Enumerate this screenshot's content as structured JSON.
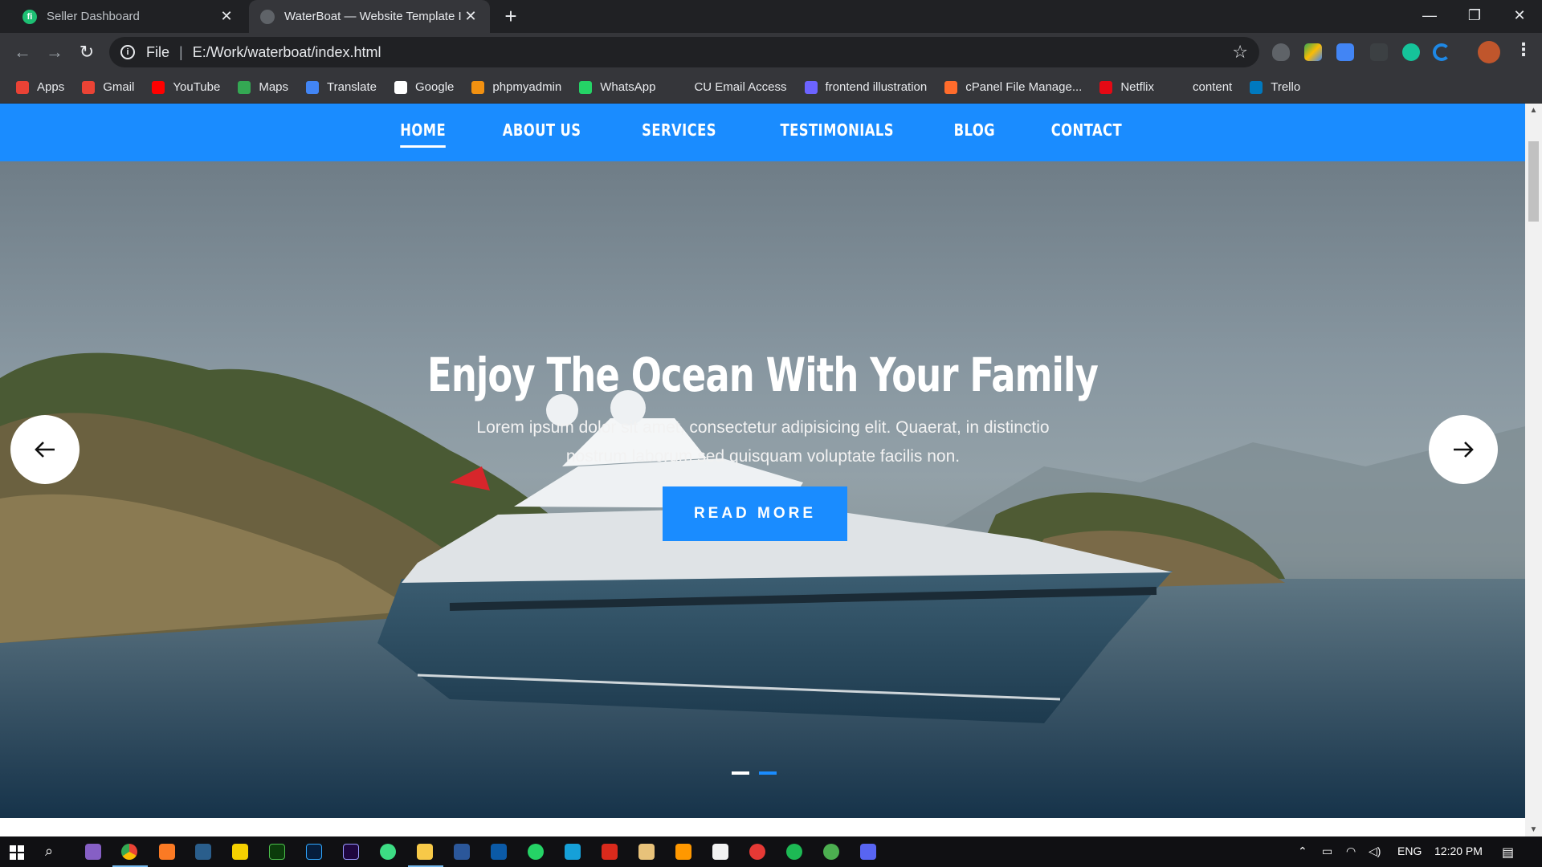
{
  "browser": {
    "tabs": [
      {
        "title": "Seller Dashboard",
        "favicon": "fiverr-icon",
        "active": false
      },
      {
        "title": "WaterBoat — Website Template I",
        "favicon": "globe-icon",
        "active": true
      }
    ],
    "address": {
      "scheme": "File",
      "url": "E:/Work/waterboat/index.html"
    },
    "bookmarks": [
      {
        "label": "Apps",
        "icon": "apps-grid-icon",
        "color": "#e94235"
      },
      {
        "label": "Gmail",
        "icon": "gmail-icon",
        "color": "#ea4335"
      },
      {
        "label": "YouTube",
        "icon": "youtube-icon",
        "color": "#ff0000"
      },
      {
        "label": "Maps",
        "icon": "maps-pin-icon",
        "color": "#34a853"
      },
      {
        "label": "Translate",
        "icon": "translate-icon",
        "color": "#4285f4"
      },
      {
        "label": "Google",
        "icon": "google-icon",
        "color": "#ffffff"
      },
      {
        "label": "phpmyadmin",
        "icon": "phpmyadmin-icon",
        "color": "#f29111"
      },
      {
        "label": "WhatsApp",
        "icon": "whatsapp-icon",
        "color": "#25d366"
      },
      {
        "label": "CU Email Access",
        "icon": "blank-icon",
        "color": "#35363a"
      },
      {
        "label": "frontend illustration",
        "icon": "frontend-icon",
        "color": "#6c63ff"
      },
      {
        "label": "cPanel File Manage...",
        "icon": "cpanel-icon",
        "color": "#ff6c2c"
      },
      {
        "label": "Netflix",
        "icon": "netflix-icon",
        "color": "#e50914"
      },
      {
        "label": "content",
        "icon": "ycombinator-icon",
        "color": "#35363a"
      },
      {
        "label": "Trello",
        "icon": "trello-icon",
        "color": "#0079bf"
      }
    ]
  },
  "site": {
    "nav": [
      {
        "label": "HOME",
        "current": true
      },
      {
        "label": "ABOUT US",
        "current": false
      },
      {
        "label": "SERVICES",
        "current": false
      },
      {
        "label": "TESTIMONIALS",
        "current": false
      },
      {
        "label": "BLOG",
        "current": false
      },
      {
        "label": "CONTACT",
        "current": false
      }
    ],
    "hero": {
      "title": "Enjoy The Ocean With Your Family",
      "subtitle": "Lorem ipsum dolor sit amet, consectetur adipisicing elit. Quaerat, in distinctio nostrum laborum sed quisquam voluptate facilis non.",
      "cta": "READ MORE",
      "slides": 2,
      "active_slide": 2
    },
    "colors": {
      "brand": "#1a8cff"
    }
  },
  "taskbar": {
    "lang": "ENG",
    "time": "12:20 PM"
  }
}
